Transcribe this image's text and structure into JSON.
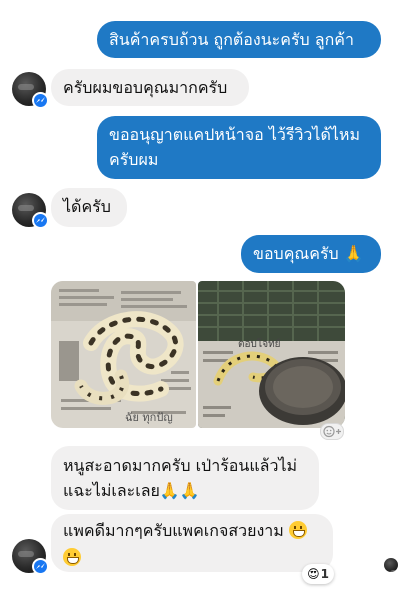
{
  "messages": {
    "m1": "สินค้าครบถ้วน ถูกต้องนะครับ ลูกค้า",
    "m2": "ครับผมขอบคุณมากครับ",
    "m3_line1": "ขออนุญาตแคปหน้าจอ ไว้รีวิวได้ไหม",
    "m3_line2": "ครับผม",
    "m4": "ได้ครับ",
    "m5": "ขอบคุณครับ 🙏",
    "m6_line1": "หนูสะอาดมากครับ เป่าร้อนแล้วไม่",
    "m6_line2": "แฉะไม่เละเลย🙏🙏",
    "m7": "แพคดีมากๆครับแพคเกจสวยงาม"
  },
  "photo_words": {
    "left_newspaper": "ฉัย ทุกปัญ",
    "right_newspaper": "ตอบโจทย์"
  },
  "reaction": {
    "emoji": "😍",
    "count": "1"
  },
  "colors": {
    "outgoing": "#1f79c5",
    "incoming": "#f1f0f0",
    "badge": "#1877f2"
  }
}
